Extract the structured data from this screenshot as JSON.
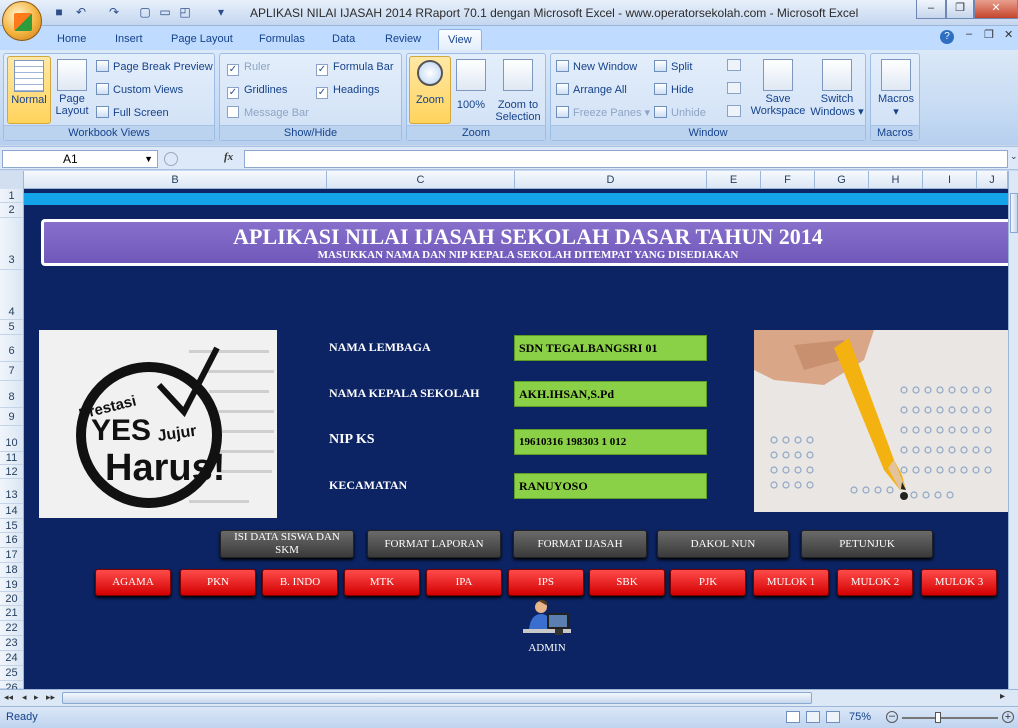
{
  "window": {
    "title": "APLIKASI NILAI IJASAH 2014 RRaport 70.1 dengan Microsoft Excel - www.operatorsekolah.com - Microsoft Excel"
  },
  "tabs": [
    "Home",
    "Insert",
    "Page Layout",
    "Formulas",
    "Data",
    "Review",
    "View"
  ],
  "active_tab": "View",
  "ribbon": {
    "workbook_views": {
      "label": "Workbook Views",
      "normal": "Normal",
      "page": "Page",
      "layout": "Layout",
      "page_break": "Page Break Preview",
      "custom": "Custom Views",
      "full": "Full Screen"
    },
    "show_hide": {
      "label": "Show/Hide",
      "ruler": "Ruler",
      "gridlines": "Gridlines",
      "message": "Message Bar",
      "formula": "Formula Bar",
      "headings": "Headings"
    },
    "zoom": {
      "label": "Zoom",
      "zoom": "Zoom",
      "pct": "100%",
      "zts1": "Zoom to",
      "zts2": "Selection"
    },
    "window": {
      "label": "Window",
      "new": "New Window",
      "arrange": "Arrange All",
      "freeze": "Freeze Panes",
      "split": "Split",
      "hide": "Hide",
      "unhide": "Unhide",
      "save1": "Save",
      "save2": "Workspace",
      "switch1": "Switch",
      "switch2": "Windows"
    },
    "macros": {
      "label": "Macros",
      "macros": "Macros"
    }
  },
  "formula_bar": {
    "name_box": "A1",
    "fx": "fx",
    "value": ""
  },
  "columns": [
    "B",
    "C",
    "D",
    "E",
    "F",
    "G",
    "H",
    "I",
    "J"
  ],
  "rows": [
    "1",
    "2",
    "3",
    "4",
    "5",
    "6",
    "7",
    "8",
    "9",
    "10",
    "11",
    "12",
    "13",
    "14",
    "15",
    "16",
    "17",
    "18",
    "19",
    "20",
    "21",
    "22",
    "23",
    "24",
    "25",
    "26"
  ],
  "sheet": {
    "title": "APLIKASI NILAI IJASAH  SEKOLAH DASAR TAHUN 2014",
    "subtitle": "MASUKKAN NAMA DAN NIP KEPALA SEKOLAH DITEMPAT YANG DISEDIAKAN",
    "labels": {
      "lembaga": "NAMA LEMBAGA",
      "kepala": "NAMA KEPALA SEKOLAH",
      "nip": "NIP KS",
      "kecamatan": "KECAMATAN"
    },
    "values": {
      "lembaga": "SDN TEGALBANGSRI 01",
      "kepala": "AKH.IHSAN,S.Pd",
      "nip": "19610316 198303 1 012",
      "kecamatan": "RANUYOSO"
    },
    "gray_buttons": [
      "ISI DATA SISWA DAN SKM",
      "FORMAT LAPORAN",
      "FORMAT IJASAH",
      "DAKOL NUN",
      "PETUNJUK"
    ],
    "red_buttons": [
      "AGAMA",
      "PKN",
      "B. INDO",
      "MTK",
      "IPA",
      "IPS",
      "SBK",
      "PJK",
      "MULOK 1",
      "MULOK 2",
      "MULOK 3"
    ],
    "admin": "ADMIN",
    "logo_text": {
      "top": "Prestasi",
      "yes": "YES",
      "jujur": "Jujur",
      "harus": "Harus!"
    }
  },
  "status": {
    "ready": "Ready",
    "zoom": "75%"
  }
}
